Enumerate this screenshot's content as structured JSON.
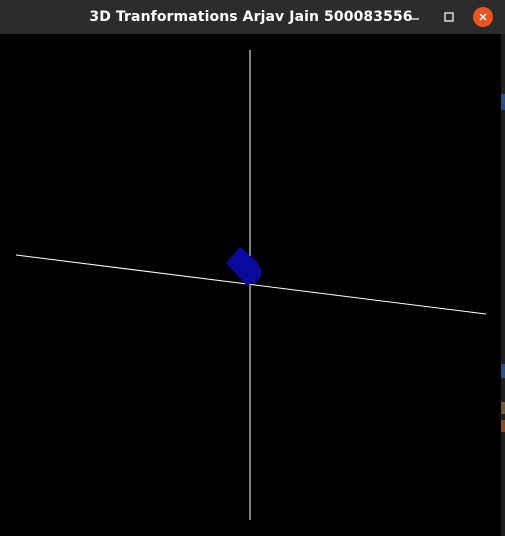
{
  "window": {
    "title": "3D Tranformations Arjav Jain 500083556",
    "controls": {
      "minimize_icon": "minimize-icon",
      "maximize_icon": "maximize-icon",
      "close_icon": "close-icon",
      "close_color": "#e95420"
    }
  },
  "scene": {
    "background": "#000000",
    "axis_color": "#ffffff",
    "object_color": "#0a0a9a"
  }
}
